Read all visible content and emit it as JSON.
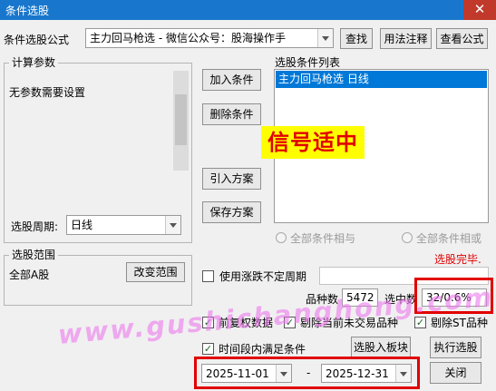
{
  "window": {
    "title": "条件选股",
    "close_glyph": "✕"
  },
  "formula": {
    "label": "条件选股公式",
    "value": "主力回马枪选  -  微信公众号：股海操作手",
    "find_label": "查找",
    "usage_label": "用法注释",
    "view_label": "查看公式"
  },
  "params": {
    "group_label": "计算参数",
    "text": "无参数需要设置",
    "period_label": "选股周期:",
    "period_value": "日线"
  },
  "buttons": {
    "add": "加入条件",
    "remove": "删除条件",
    "import": "引入方案",
    "save": "保存方案",
    "change_range": "改变范围",
    "to_block": "选股入板块",
    "execute": "执行选股",
    "close": "关闭"
  },
  "conditions": {
    "label": "选股条件列表",
    "items": [
      "主力回马枪选  日线"
    ]
  },
  "logic": {
    "and_label": "全部条件相与",
    "or_label": "全部条件相或"
  },
  "status": {
    "text": "选股完毕."
  },
  "range": {
    "group_label": "选股范围",
    "value": "全部A股"
  },
  "options": {
    "variable_period": "使用涨跌不定周期",
    "forward_adjust": "前复权数据",
    "exclude_untraded": "剔除当前未交易品种",
    "exclude_st": "剔除ST品种",
    "period_condition": "时间段内满足条件"
  },
  "stats": {
    "count_label": "品种数",
    "count_value": "5472",
    "selected_label": "选中数",
    "selected_value": "32/0.6%"
  },
  "dates": {
    "start": "2025-11-01",
    "separator": "-",
    "end": "2025-12-31"
  },
  "overlays": {
    "signal_text": "信号适中",
    "watermark": "www.gushichanghong.com"
  },
  "colors": {
    "titlebar": "#1877cc",
    "selection": "#0078d7",
    "accent_red": "#e10000",
    "signal_bg": "#fffe00"
  }
}
